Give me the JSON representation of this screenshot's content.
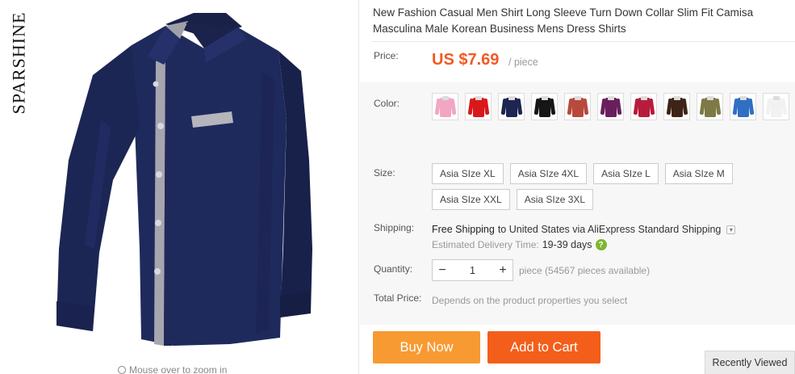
{
  "image": {
    "brand": "SPARSHINE",
    "zoom_hint": "Mouse over to zoom in"
  },
  "product": {
    "title": "New Fashion Casual Men Shirt Long Sleeve Turn Down Collar Slim Fit Camisa Masculina Male Korean Business Mens Dress Shirts"
  },
  "price": {
    "label": "Price:",
    "value": "US $7.69",
    "unit": "/ piece",
    "color": "#f15a24"
  },
  "color": {
    "label": "Color:",
    "options": [
      {
        "name": "pink",
        "hex": "#f2a6c4"
      },
      {
        "name": "red",
        "hex": "#d9181c"
      },
      {
        "name": "navy",
        "hex": "#1d2550"
      },
      {
        "name": "black",
        "hex": "#161616"
      },
      {
        "name": "brick",
        "hex": "#b8493c"
      },
      {
        "name": "purple",
        "hex": "#6a1f5c"
      },
      {
        "name": "crimson",
        "hex": "#b81c3c"
      },
      {
        "name": "brown",
        "hex": "#3e2418"
      },
      {
        "name": "olive",
        "hex": "#7d7a45"
      },
      {
        "name": "blue",
        "hex": "#2f6fc4"
      },
      {
        "name": "white",
        "hex": "#f2f2f2"
      }
    ]
  },
  "size": {
    "label": "Size:",
    "options": [
      "Asia SIze XL",
      "Asia SIze 4XL",
      "Asia SIze L",
      "Asia SIze M",
      "Asia SIze XXL",
      "Asia SIze 3XL"
    ]
  },
  "shipping": {
    "label": "Shipping:",
    "free": "Free Shipping",
    "to_text": "to United States via AliExpress Standard Shipping",
    "est_label": "Estimated Delivery Time:",
    "est_days": "19-39 days",
    "help_icon": "?"
  },
  "quantity": {
    "label": "Quantity:",
    "minus": "−",
    "value": "1",
    "plus": "+",
    "note": "piece (54567 pieces available)"
  },
  "total": {
    "label": "Total Price:",
    "note": "Depends on the product properties you select"
  },
  "actions": {
    "buy_now": "Buy Now",
    "add_to_cart": "Add to Cart",
    "buy_color": "#f89a32",
    "cart_color": "#f45e1b"
  },
  "recently_viewed": "Recently Viewed"
}
